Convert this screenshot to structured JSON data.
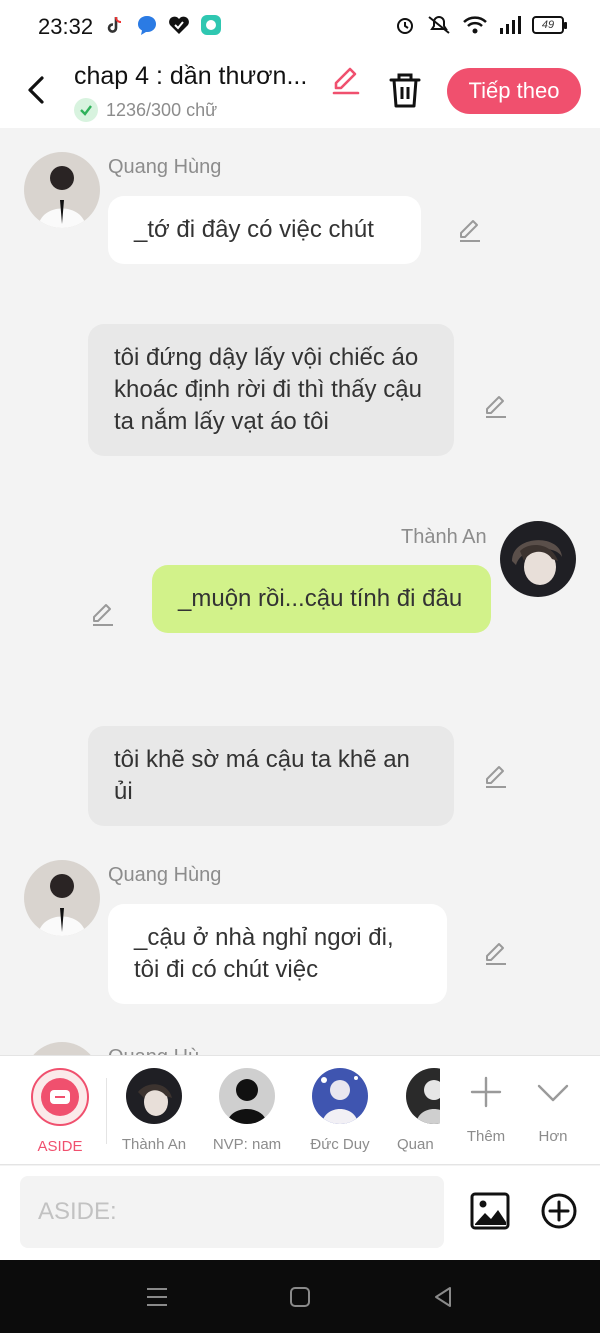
{
  "status_bar": {
    "time": "23:32",
    "battery": "49"
  },
  "header": {
    "title": "chap 4 : dần thươn...",
    "word_count": "1236/300 chữ",
    "next_label": "Tiếp theo"
  },
  "messages": [
    {
      "sender": "Quang Hùng",
      "text": "_tớ đi đây có việc chút"
    },
    {
      "text": "tôi đứng dậy lấy vội chiếc áo khoác định rời đi thì thấy cậu ta nắm lấy vạt áo tôi"
    },
    {
      "sender": "Thành An",
      "text": "_muộn rồi...cậu tính đi đâu"
    },
    {
      "text": "tôi khẽ sờ má cậu ta khẽ an ủi"
    },
    {
      "sender": "Quang Hùng",
      "text": "_cậu ở nhà nghỉ ngơi đi, tôi đi có chút việc"
    },
    {
      "sender": "Quang Hù"
    }
  ],
  "characters": [
    {
      "label": "ASIDE"
    },
    {
      "label": "Thành An"
    },
    {
      "label": "NVP: nam"
    },
    {
      "label": "Đức Duy"
    },
    {
      "label": "Quan"
    },
    {
      "label": "Thêm"
    },
    {
      "label": "Hơn"
    }
  ],
  "input": {
    "placeholder": "ASIDE:"
  },
  "colors": {
    "accent": "#f0506e",
    "green_bubble": "#d2f28a",
    "gray_bubble": "#e8e8e8"
  }
}
